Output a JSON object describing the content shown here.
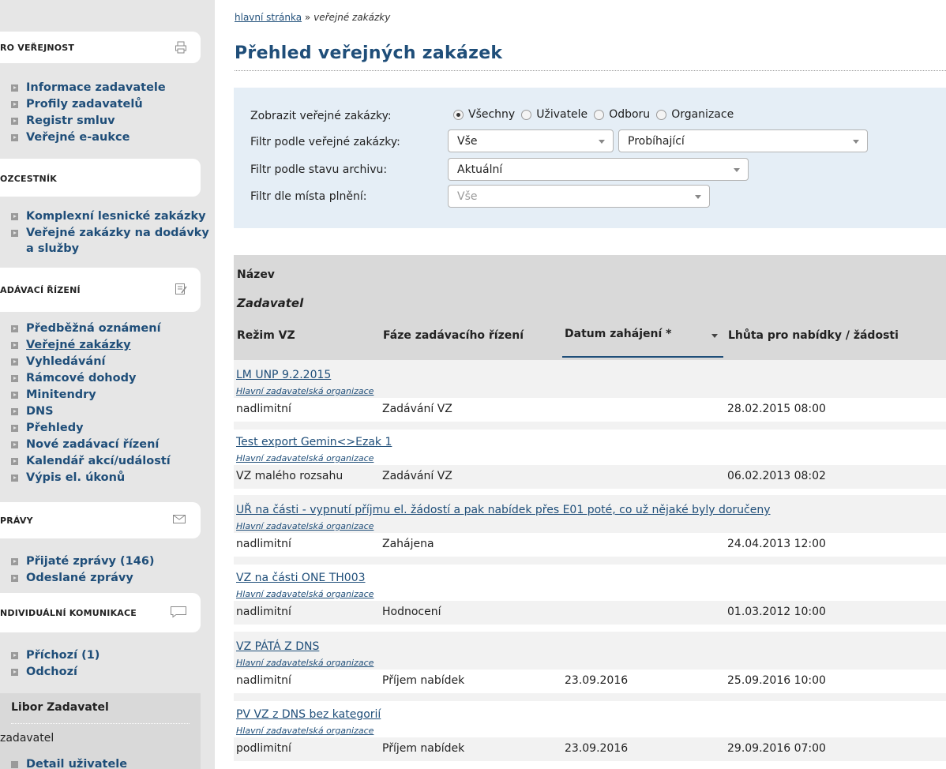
{
  "sidebar": {
    "sections": [
      {
        "title": "RO VEŘEJNOST",
        "icon": "printer-icon",
        "items": [
          "Informace zadavatele",
          "Profily zadavatelů",
          "Registr smluv",
          "Veřejné e-aukce"
        ]
      },
      {
        "title": "OZCESTNÍK",
        "icon": "",
        "items": [
          "Komplexní lesnické zakázky",
          "Veřejné zakázky na dodávky a služby"
        ]
      },
      {
        "title": "ADÁVACÍ ŘÍZENÍ",
        "icon": "edit-document-icon",
        "items": [
          "Předběžná oznámení",
          "Veřejné zakázky",
          "Vyhledávání",
          "Rámcové dohody",
          "Minitendry",
          "DNS",
          "Přehledy",
          "Nové zadávací řízení",
          "Kalendář akcí/událostí",
          "Výpis el. úkonů"
        ]
      },
      {
        "title": "PRÁVY",
        "icon": "envelope-icon",
        "items": [
          "Přijaté zprávy (146)",
          "Odeslané zprávy"
        ]
      },
      {
        "title": "NDIVIDUÁLNÍ KOMUNIKACE",
        "icon": "speech-bubble-icon",
        "items": [
          "Příchozí (1)",
          "Odchozí"
        ]
      }
    ],
    "user": {
      "name": "Libor Zadavatel",
      "role": "zadavatel",
      "detail_link": "Detail uživatele"
    }
  },
  "breadcrumb": {
    "home": "hlavní stránka",
    "separator": "»",
    "current": "veřejné zakázky"
  },
  "page_title": "Přehled veřejných zakázek",
  "filters": {
    "show_label": "Zobrazit veřejné zakázky:",
    "show_options": [
      "Všechny",
      "Uživatele",
      "Odboru",
      "Organizace"
    ],
    "show_selected": "Všechny",
    "filter_vz_label": "Filtr podle veřejné zakázky:",
    "filter_vz_value": "Vše",
    "filter_vz_state": "Probíhající",
    "archive_label": "Filtr podle stavu archivu:",
    "archive_value": "Aktuální",
    "place_label": "Filtr dle místa plnění:",
    "place_value": "Vše"
  },
  "table": {
    "headers": {
      "name": "Název",
      "contracting": "Zadavatel",
      "mode": "Režim VZ",
      "phase": "Fáze zadávacího řízení",
      "start": "Datum zahájení *",
      "deadline": "Lhůta pro nabídky / žádosti"
    },
    "rows": [
      {
        "name": "LM UNP 9.2.2015",
        "org": "Hlavní zadavatelská organizace",
        "mode": "nadlimitní",
        "phase": "Zadávání VZ",
        "start": "",
        "deadline": "28.02.2015 08:00"
      },
      {
        "name": "Test export Gemin<>Ezak 1",
        "org": "Hlavní zadavatelská organizace",
        "mode": "VZ malého rozsahu",
        "phase": "Zadávání VZ",
        "start": "",
        "deadline": "06.02.2013 08:02"
      },
      {
        "name": "UŘ na části - vypnutí příjmu el. žádostí a pak nabídek přes E01 poté, co už nějaké byly doručeny",
        "org": "Hlavní zadavatelská organizace",
        "mode": "nadlimitní",
        "phase": "Zahájena",
        "start": "",
        "deadline": "24.04.2013 12:00"
      },
      {
        "name": "VZ na části ONE TH003",
        "org": "Hlavní zadavatelská organizace",
        "mode": "nadlimitní",
        "phase": "Hodnocení",
        "start": "",
        "deadline": "01.03.2012 10:00"
      },
      {
        "name": "VZ PÁTÁ Z DNS",
        "org": "Hlavní zadavatelská organizace",
        "mode": "nadlimitní",
        "phase": "Příjem nabídek",
        "start": "23.09.2016",
        "deadline": "25.09.2016 10:00"
      },
      {
        "name": "PV VZ z DNS bez kategorií",
        "org": "Hlavní zadavatelská organizace",
        "mode": "podlimitní",
        "phase": "Příjem nabídek",
        "start": "23.09.2016",
        "deadline": "29.09.2016 07:00"
      }
    ]
  }
}
